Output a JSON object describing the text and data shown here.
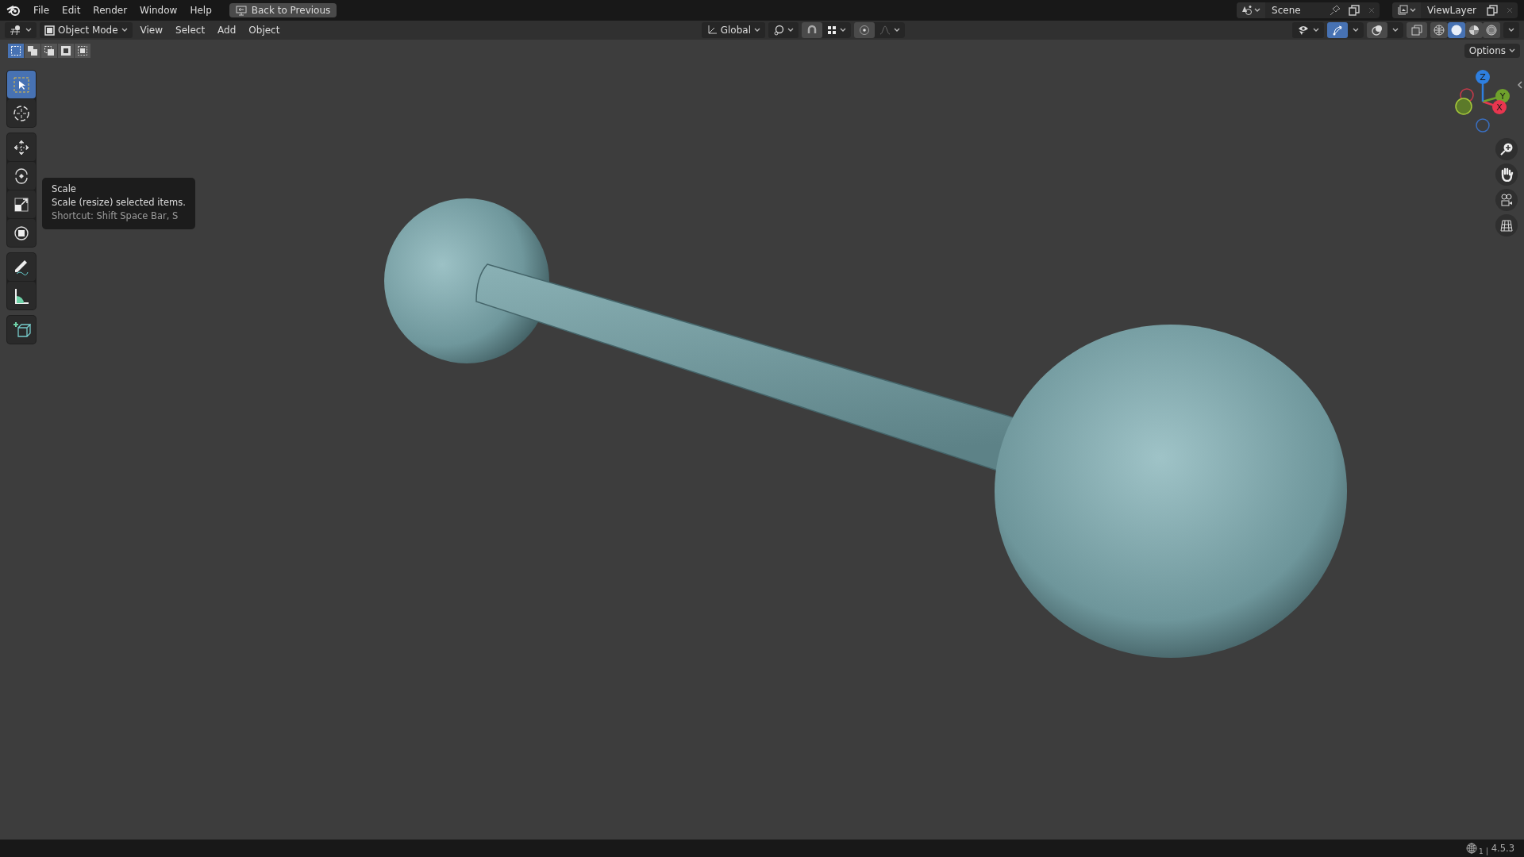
{
  "top_bar": {
    "menus": [
      "File",
      "Edit",
      "Render",
      "Window",
      "Help"
    ],
    "back_button": "Back to Previous",
    "scene": "Scene",
    "view_layer": "ViewLayer"
  },
  "header": {
    "mode": "Object Mode",
    "menus": [
      "View",
      "Select",
      "Add",
      "Object"
    ],
    "orientation": "Global",
    "gizmo_toggle": {
      "on": true
    },
    "shading_modes": [
      {
        "kind": "wireframe",
        "selected": false
      },
      {
        "kind": "solid",
        "selected": true
      },
      {
        "kind": "material",
        "selected": false
      },
      {
        "kind": "rendered",
        "selected": false
      }
    ]
  },
  "select_modes": [
    {
      "kind": "new",
      "selected": true
    },
    {
      "kind": "extend",
      "selected": false
    },
    {
      "kind": "subtract",
      "selected": false
    },
    {
      "kind": "invert",
      "selected": false
    },
    {
      "kind": "intersect",
      "selected": false
    }
  ],
  "options_button": "Options",
  "tool_groups": [
    [
      {
        "kind": "select_box",
        "selected": true
      },
      {
        "kind": "cursor",
        "selected": false
      }
    ],
    [
      {
        "kind": "move",
        "selected": false
      },
      {
        "kind": "rotate",
        "selected": false
      },
      {
        "kind": "scale",
        "selected": false
      },
      {
        "kind": "transform",
        "selected": false
      }
    ],
    [
      {
        "kind": "annotate",
        "selected": false
      },
      {
        "kind": "measure",
        "selected": false
      }
    ],
    [
      {
        "kind": "add_cube",
        "selected": false
      }
    ]
  ],
  "tooltip": {
    "title": "Scale",
    "description": "Scale (resize) selected items.",
    "shortcut": "Shortcut: Shift Space Bar, S"
  },
  "gizmo": {
    "axes": [
      {
        "kind": "positive",
        "label": "Z",
        "color": "#2e7fe0"
      },
      {
        "kind": "positive",
        "label": "Y",
        "color": "#6fa12c"
      },
      {
        "kind": "positive",
        "label": "X",
        "color": "#e8364f"
      },
      {
        "kind": "negative",
        "color": "#c83a4a",
        "filled": false
      },
      {
        "kind": "negative",
        "color": "#a6c93a",
        "filled": true
      },
      {
        "kind": "negative",
        "color": "#3a6fc0",
        "filled": false
      }
    ]
  },
  "status_bar": {
    "scene_count": "1",
    "version": "4.5.3"
  }
}
